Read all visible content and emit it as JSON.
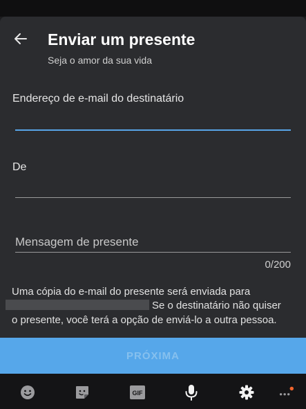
{
  "header": {
    "back_icon": "arrow-left-icon",
    "title": "Enviar um presente",
    "subtitle": "Seja o amor da sua vida"
  },
  "form": {
    "email_label": "Endereço de e-mail do destinatário",
    "email_value": "",
    "from_label": "De",
    "from_value": "",
    "message_placeholder": "Mensagem de presente",
    "message_value": "",
    "counter": "0/200"
  },
  "info": {
    "line1": "Uma cópia do e-mail do presente será enviada para",
    "line2": "Se o destinatário não quiser",
    "line3": "o presente, você terá a opção de enviá-lo a outra pessoa."
  },
  "next_button": {
    "label": "PRÓXIMA"
  },
  "bottom_bar": {
    "items": [
      {
        "icon": "emoji-icon"
      },
      {
        "icon": "sticker-icon"
      },
      {
        "icon": "gif-icon",
        "label": "GIF"
      },
      {
        "icon": "microphone-icon"
      },
      {
        "icon": "gear-icon"
      },
      {
        "icon": "more-icon"
      }
    ]
  },
  "colors": {
    "accent": "#58a6e8",
    "button": "#56a7ea",
    "sheet": "#2b2c2f",
    "notification_dot": "#f0642d"
  }
}
